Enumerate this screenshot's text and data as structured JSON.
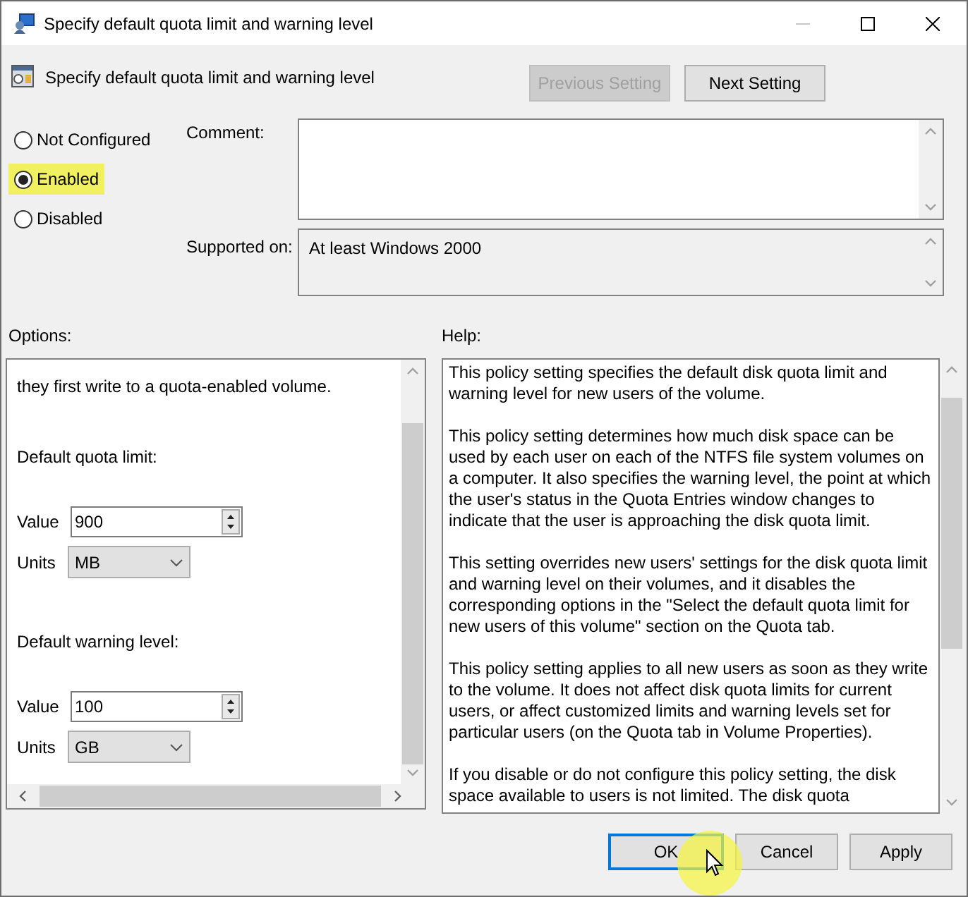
{
  "window": {
    "title": "Specify default quota limit and warning level"
  },
  "header": {
    "title": "Specify default quota limit and warning level"
  },
  "nav_buttons": [
    {
      "label": "Previous Setting",
      "disabled": true
    },
    {
      "label": "Next Setting",
      "disabled": false
    }
  ],
  "state_options": [
    {
      "label": "Not Configured",
      "selected": false
    },
    {
      "label": "Enabled",
      "selected": true
    },
    {
      "label": "Disabled",
      "selected": false
    }
  ],
  "comment": {
    "label": "Comment:"
  },
  "supported_on": {
    "label": "Supported on:",
    "value": "At least Windows 2000"
  },
  "options": {
    "label": "Options:",
    "intro": "they first write to a quota-enabled volume.",
    "sections": [
      {
        "heading": "Default quota limit:",
        "value_label": "Value",
        "value": "900",
        "units_label": "Units",
        "units": "MB"
      },
      {
        "heading": "Default warning level:",
        "value_label": "Value",
        "value": "100",
        "units_label": "Units",
        "units": "GB"
      }
    ]
  },
  "help": {
    "label": "Help:",
    "paragraphs": [
      "This policy setting specifies the default disk quota limit and warning level for new users of the volume.",
      "This policy setting determines how much disk space can be used by each user on each of the NTFS file system volumes on a computer. It also specifies the warning level, the point at which the user's status in the Quota Entries window changes to indicate that the user is approaching the disk quota limit.",
      "This setting overrides new users' settings for the disk quota limit and warning level on their volumes, and it disables the corresponding options in the \"Select the default quota limit for new users of this volume\" section on the Quota tab.",
      "This policy setting applies to all new users as soon as they write to the volume. It does not affect disk quota limits for current users, or affect customized limits and warning levels set for particular users (on the Quota tab in Volume Properties).",
      "If you disable or do not configure this policy setting, the disk space available to users is not limited. The disk quota"
    ]
  },
  "buttons": [
    {
      "label": "OK",
      "default": true
    },
    {
      "label": "Cancel",
      "default": false
    },
    {
      "label": "Apply",
      "default": false
    }
  ]
}
